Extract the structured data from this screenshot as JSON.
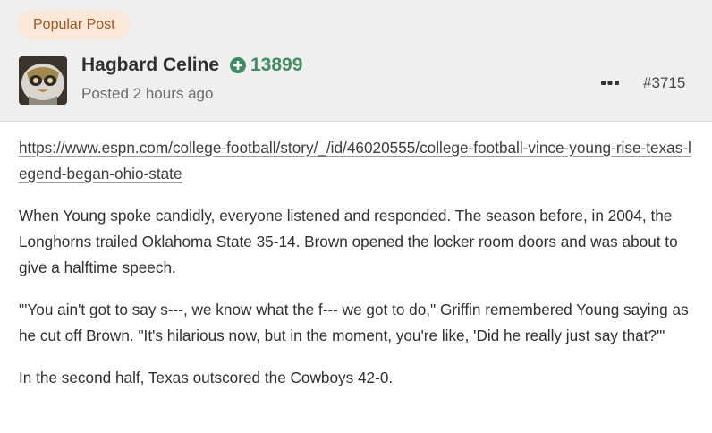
{
  "post": {
    "badge": "Popular Post",
    "author": {
      "name": "Hagbard Celine",
      "reputation": "13899",
      "reputation_icon": "plus-circle-icon",
      "avatar_icon": "avatar-image"
    },
    "posted": "Posted 2 hours ago",
    "post_number": "#3715",
    "more_icon": "ellipsis-icon",
    "body": {
      "link": "https://www.espn.com/college-football/story/_/id/46020555/college-football-vince-young-rise-texas-legend-began-ohio-state",
      "paragraphs": [
        "When Young spoke candidly, everyone listened and responded. The season before, in 2004, the Longhorns trailed Oklahoma State 35-14. Brown opened the locker room doors and was about to give a halftime speech.",
        "\"'You ain't got to say s---, we know what the f--- we got to do,\" Griffin remembered Young saying as he cut off Brown. \"It's hilarious now, but in the moment, you're like, 'Did he really just say that?'\"",
        "In the second half, Texas outscored the Cowboys 42-0."
      ]
    }
  },
  "colors": {
    "header_bg": "#efefef",
    "badge_bg": "#fbe8d8",
    "badge_text": "#a0561d",
    "reputation_green": "#3f8d63"
  }
}
